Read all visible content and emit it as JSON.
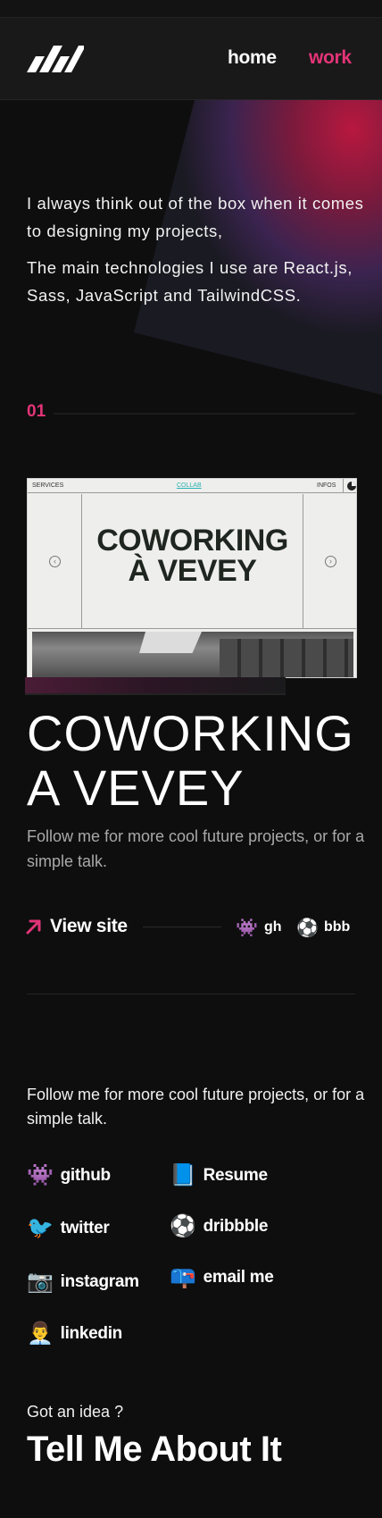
{
  "nav": {
    "home": "home",
    "work": "work"
  },
  "hero": {
    "line1": "I always think out of the box when it comes to designing my projects,",
    "line2": "The main technologies I use are React.js, Sass, JavaScript and TailwindCSS."
  },
  "project": {
    "number": "01",
    "preview": {
      "nav_services": "SERVICES",
      "nav_collab": "COLLAB",
      "nav_infos": "INFOS",
      "title_line1": "COWORKING",
      "title_line2": "À VEVEY"
    },
    "title_line1": "COWORKING",
    "title_line2": "A VEVEY",
    "description": "Follow me for more cool future projects, or for a simple talk.",
    "view_site": "View site",
    "gh": "gh",
    "bbb": "bbb"
  },
  "contact": {
    "intro": "Follow me for more cool future projects, or for a simple talk.",
    "links": {
      "github": "github",
      "resume": "Resume",
      "twitter": "twitter",
      "dribbble": "dribbble",
      "instagram": "instagram",
      "email": "email me",
      "linkedin": "linkedin"
    },
    "icons": {
      "github": "👾",
      "resume": "📘",
      "twitter": "🐦",
      "dribbble": "⚽",
      "instagram": "📷",
      "email": "📪",
      "linkedin": "👨‍💼"
    }
  },
  "cta": {
    "question": "Got an idea ?",
    "headline": "Tell Me About It"
  },
  "colors": {
    "accent": "#e33477",
    "background": "#0e0e0f",
    "header": "#191919"
  }
}
